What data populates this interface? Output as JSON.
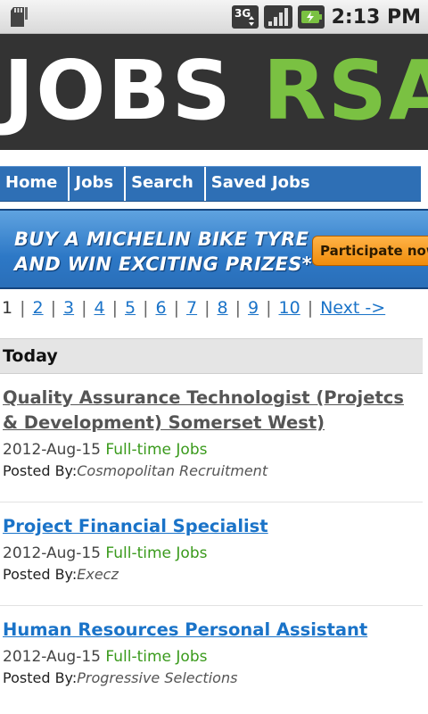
{
  "status_bar": {
    "network_label": "3G",
    "time": "2:13 PM",
    "icons": [
      "sd-card-icon",
      "network-3g-icon",
      "signal-icon",
      "battery-charging-icon"
    ]
  },
  "logo": {
    "part1": "JOBS",
    "part2": "RSA",
    "colors": {
      "background": "#333333",
      "jobs": "#ffffff",
      "rsa": "#7ac142"
    }
  },
  "nav": {
    "items": [
      {
        "label": "Home"
      },
      {
        "label": "Jobs"
      },
      {
        "label": "Search"
      },
      {
        "label": "Saved Jobs"
      }
    ],
    "color": "#2e6fb5"
  },
  "ad": {
    "line1": "BUY A MICHELIN BIKE TYRE",
    "line2": "AND WIN EXCITING PRIZES*",
    "cta": "Participate now"
  },
  "pagination": {
    "current": "1",
    "pages": [
      "2",
      "3",
      "4",
      "5",
      "6",
      "7",
      "8",
      "9",
      "10"
    ],
    "next": "Next ->"
  },
  "section": {
    "title": "Today"
  },
  "jobs": [
    {
      "title": "Quality Assurance Technologist (Projetcs & Development) Somerset West)",
      "date": "2012-Aug-15",
      "type": "Full-time Jobs",
      "posted_label": "Posted By:",
      "agency": "Cosmopolitan Recruitment",
      "visited": true
    },
    {
      "title": "Project Financial Specialist",
      "date": "2012-Aug-15",
      "type": "Full-time Jobs",
      "posted_label": "Posted By:",
      "agency": "Execz",
      "visited": false
    },
    {
      "title": "Human Resources Personal Assistant",
      "date": "2012-Aug-15",
      "type": "Full-time Jobs",
      "posted_label": "Posted By:",
      "agency": "Progressive Selections",
      "visited": false
    }
  ]
}
